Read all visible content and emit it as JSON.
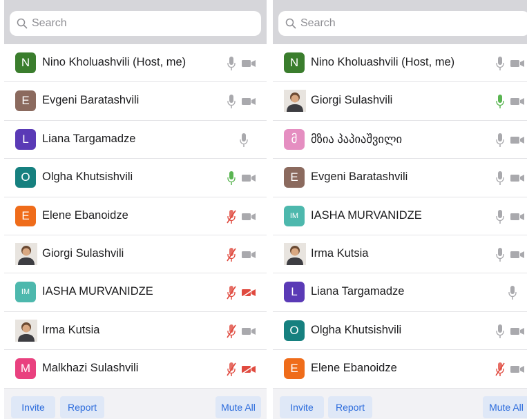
{
  "colors": {
    "accent": "#2b6bdc",
    "muted_icon": "#a9a9ad",
    "mic_active": "#5ab552",
    "muted_red": "#e04a3f"
  },
  "left_panel": {
    "search_placeholder": "Search",
    "participants": [
      {
        "name": "Nino Kholuashvili (Host, me)",
        "initial": "N",
        "avatar_color": "#3a7d2d",
        "photo": false,
        "mic": "on",
        "video": "on"
      },
      {
        "name": "Evgeni Baratashvili",
        "initial": "E",
        "avatar_color": "#8b6a5e",
        "photo": false,
        "mic": "on",
        "video": "on"
      },
      {
        "name": "Liana Targamadze",
        "initial": "L",
        "avatar_color": "#5a3ab6",
        "photo": false,
        "mic": "on",
        "video": "none"
      },
      {
        "name": "Olgha Khutsishvili",
        "initial": "O",
        "avatar_color": "#16807f",
        "photo": false,
        "mic": "speaking",
        "video": "on"
      },
      {
        "name": "Elene Ebanoidze",
        "initial": "E",
        "avatar_color": "#ef6c1a",
        "photo": false,
        "mic": "muted",
        "video": "on"
      },
      {
        "name": "Giorgi Sulashvili",
        "initial": "",
        "avatar_color": "",
        "photo": true,
        "mic": "muted",
        "video": "on"
      },
      {
        "name": "IASHA MURVANIDZE",
        "initial": "IM",
        "avatar_color": "#4db8ad",
        "photo": false,
        "mic": "muted",
        "video": "off"
      },
      {
        "name": "Irma Kutsia",
        "initial": "",
        "avatar_color": "",
        "photo": true,
        "mic": "muted",
        "video": "on"
      },
      {
        "name": "Malkhazi Sulashvili",
        "initial": "M",
        "avatar_color": "#e9417f",
        "photo": false,
        "mic": "muted",
        "video": "off"
      }
    ],
    "buttons": {
      "invite": "Invite",
      "report": "Report",
      "mute_all": "Mute All"
    }
  },
  "right_panel": {
    "search_placeholder": "Search",
    "participants": [
      {
        "name": "Nino Kholuashvili (Host, me)",
        "initial": "N",
        "avatar_color": "#3a7d2d",
        "photo": false,
        "mic": "on",
        "video": "on"
      },
      {
        "name": "Giorgi Sulashvili",
        "initial": "",
        "avatar_color": "",
        "photo": true,
        "mic": "speaking",
        "video": "on"
      },
      {
        "name": "მზია პაპიაშვილი",
        "initial": "მ",
        "avatar_color": "#e58ec1",
        "photo": false,
        "mic": "on",
        "video": "on"
      },
      {
        "name": "Evgeni Baratashvili",
        "initial": "E",
        "avatar_color": "#8b6a5e",
        "photo": false,
        "mic": "on",
        "video": "on"
      },
      {
        "name": "IASHA MURVANIDZE",
        "initial": "IM",
        "avatar_color": "#4db8ad",
        "photo": false,
        "mic": "on",
        "video": "on"
      },
      {
        "name": "Irma Kutsia",
        "initial": "",
        "avatar_color": "",
        "photo": true,
        "mic": "on",
        "video": "on"
      },
      {
        "name": "Liana Targamadze",
        "initial": "L",
        "avatar_color": "#5a3ab6",
        "photo": false,
        "mic": "on",
        "video": "none"
      },
      {
        "name": "Olgha Khutsishvili",
        "initial": "O",
        "avatar_color": "#16807f",
        "photo": false,
        "mic": "on",
        "video": "on"
      },
      {
        "name": "Elene Ebanoidze",
        "initial": "E",
        "avatar_color": "#ef6c1a",
        "photo": false,
        "mic": "muted",
        "video": "on"
      }
    ],
    "buttons": {
      "invite": "Invite",
      "report": "Report",
      "mute_all": "Mute All"
    }
  }
}
